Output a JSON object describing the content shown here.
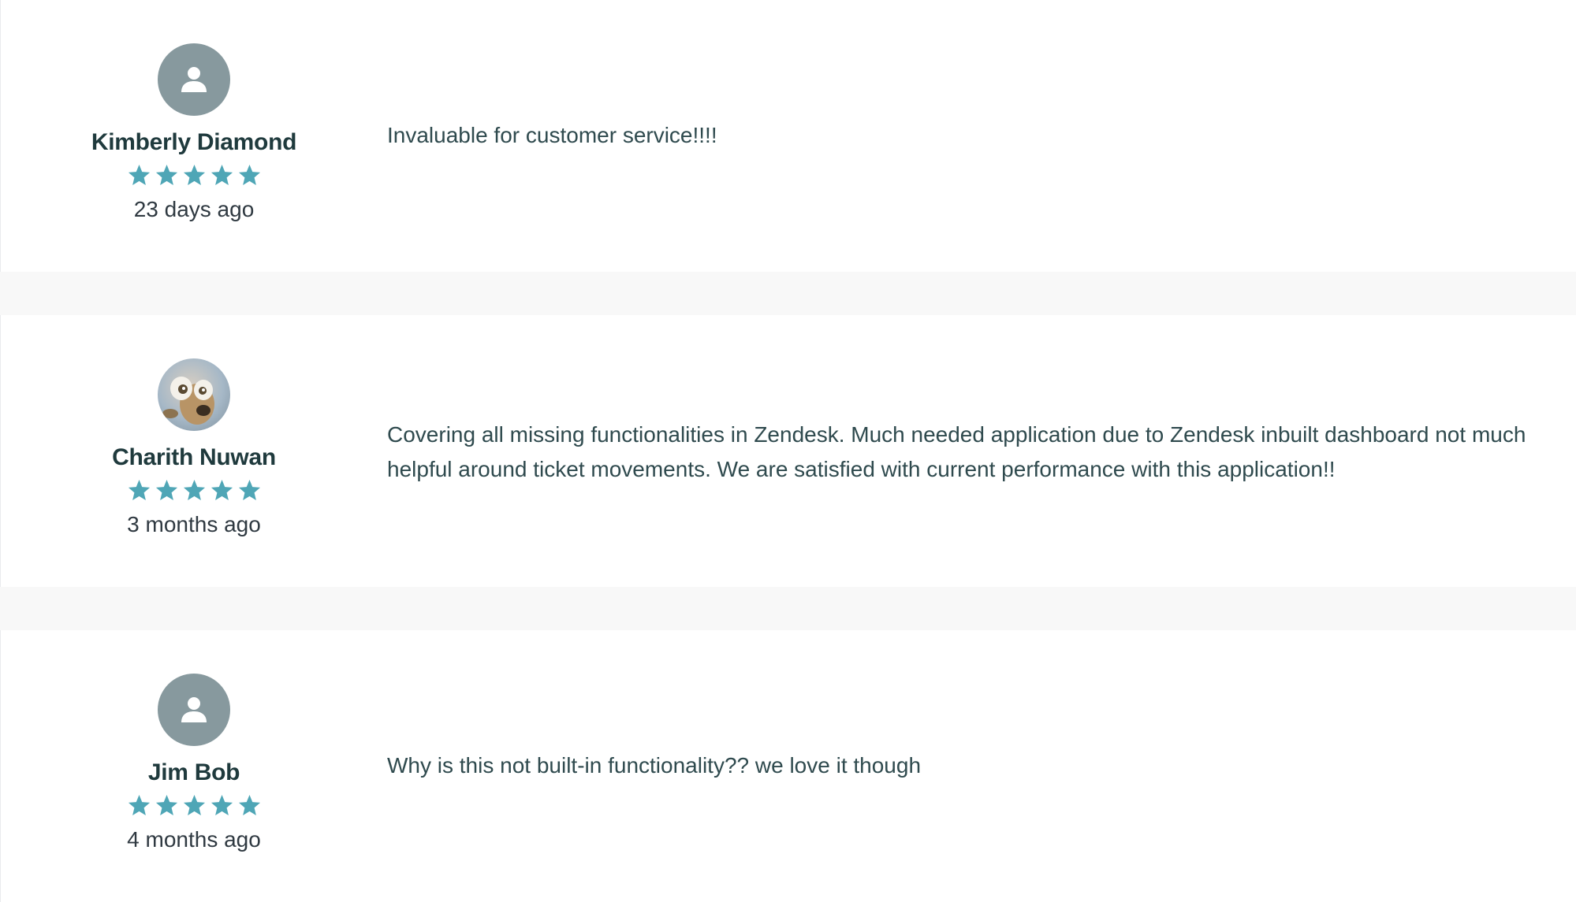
{
  "colors": {
    "star": "#4fa6b6",
    "avatar_default": "#87999e",
    "separator": "#f8f8f8",
    "card": "#ffffff",
    "text": "#2f3941"
  },
  "reviews": [
    {
      "author": "Kimberly Diamond",
      "avatar": "default-user-icon",
      "rating": 5,
      "max_rating": 5,
      "date": "23 days ago",
      "text": "Invaluable for customer service!!!!"
    },
    {
      "author": "Charith Nuwan",
      "avatar": "profile-photo",
      "rating": 5,
      "max_rating": 5,
      "date": "3 months ago",
      "text": "Covering all missing functionalities in Zendesk. Much needed application due to Zendesk inbuilt dashboard not much helpful around ticket movements. We are satisfied with current performance with this application!!"
    },
    {
      "author": "Jim Bob",
      "avatar": "default-user-icon",
      "rating": 5,
      "max_rating": 5,
      "date": "4 months ago",
      "text": "Why is this not built-in functionality?? we love it though"
    }
  ]
}
